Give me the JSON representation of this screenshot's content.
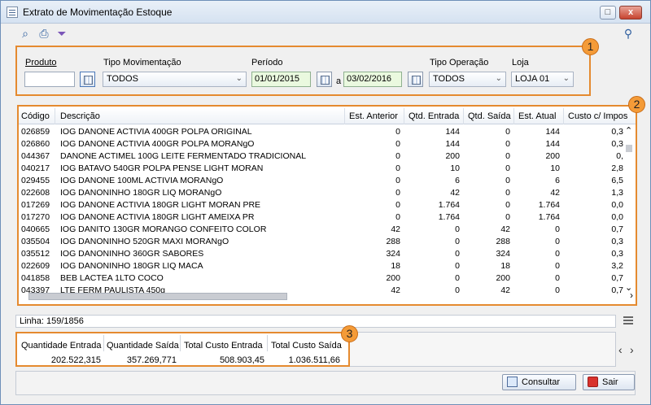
{
  "window": {
    "title": "Extrato de Movimentação Estoque",
    "controls": [
      "□",
      "▭",
      "x"
    ]
  },
  "toolbar": {
    "icons": [
      "search-icon",
      "print-icon",
      "filter-icon",
      "help-icon"
    ]
  },
  "filters": {
    "badge": "1",
    "produto_label": "Produto",
    "tipo_movimentacao_label": "Tipo Movimentação",
    "tipo_movimentacao_value": "TODOS",
    "periodo_label": "Período",
    "date_start": "01/01/2015",
    "date_end": "03/02/2016",
    "date_separator": "a",
    "tipo_operacao_label": "Tipo Operação",
    "tipo_operacao_value": "TODOS",
    "loja_label": "Loja",
    "loja_value": "LOJA 01"
  },
  "table": {
    "badge": "2",
    "headers": [
      "Código",
      "Descrição",
      "Est. Anterior",
      "Qtd. Entrada",
      "Qtd. Saída",
      "Est. Atual",
      "Custo c/ Impos"
    ],
    "rows": [
      [
        "026859",
        "IOG DANONE ACTIVIA 400GR POLPA ORIGINAL",
        "0",
        "144",
        "0",
        "144",
        "0,3"
      ],
      [
        "026860",
        "IOG DANONE ACTIVIA 400GR POLPA MORANgO",
        "0",
        "144",
        "0",
        "144",
        "0,3"
      ],
      [
        "044367",
        "DANONE ACTIMEL 100G LEITE FERMENTADO TRADICIONAL",
        "0",
        "200",
        "0",
        "200",
        "0,"
      ],
      [
        "040217",
        "IOG BATAVO 540GR POLPA PENSE LIGHT MORAN",
        "0",
        "10",
        "0",
        "10",
        "2,8"
      ],
      [
        "029455",
        "IOG DANONE 100ML ACTIVIA MORANgO",
        "0",
        "6",
        "0",
        "6",
        "6,5"
      ],
      [
        "022608",
        "IOG DANONINHO 180GR LIQ MORANgO",
        "0",
        "42",
        "0",
        "42",
        "1,3"
      ],
      [
        "017269",
        "IOG DANONE ACTIVIA 180GR LIGHT MORAN PRE",
        "0",
        "1.764",
        "0",
        "1.764",
        "0,0"
      ],
      [
        "017270",
        "IOG DANONE ACTIVIA 180GR LIGHT AMEIXA PR",
        "0",
        "1.764",
        "0",
        "1.764",
        "0,0"
      ],
      [
        "040665",
        "IOG DANITO 130GR MORANGO CONFEITO COLOR",
        "42",
        "0",
        "42",
        "0",
        "0,7"
      ],
      [
        "035504",
        "IOG DANONINHO 520GR MAXI MORANgO",
        "288",
        "0",
        "288",
        "0",
        "0,3"
      ],
      [
        "035512",
        "IOG DANONINHO 360GR SABORES",
        "324",
        "0",
        "324",
        "0",
        "0,3"
      ],
      [
        "022609",
        "IOG DANONINHO 180GR LIQ MACA",
        "18",
        "0",
        "18",
        "0",
        "3,2"
      ],
      [
        "041858",
        "BEB LACTEA 1LTO COCO",
        "200",
        "0",
        "200",
        "0",
        "0,7"
      ],
      [
        "043397",
        "LTE FERM PAULISTA 450g",
        "42",
        "0",
        "42",
        "0",
        "0,7"
      ]
    ]
  },
  "status": {
    "linha": "Linha: 159/1856"
  },
  "totals": {
    "badge": "3",
    "headers": [
      "Quantidade Entrada",
      "Quantidade Saída",
      "Total Custo Entrada",
      "Total Custo Saída"
    ],
    "values": [
      "202.522,315",
      "357.269,771",
      "508.903,45",
      "1.036.511,66"
    ]
  },
  "buttons": {
    "consultar": "Consultar",
    "sair": "Sair"
  },
  "colors": {
    "highlight": "#e58a2f",
    "date_bg": "#eaf9df",
    "window_bg": "#f0f0f0"
  }
}
